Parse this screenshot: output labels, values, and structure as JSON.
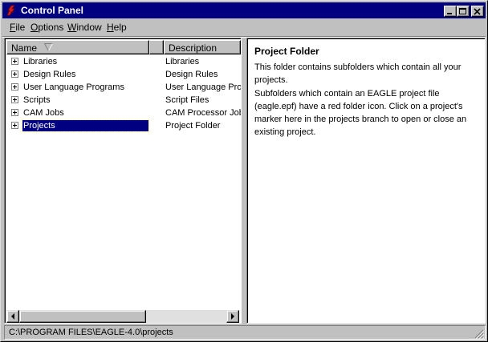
{
  "window": {
    "title": "Control Panel",
    "app_icon": "eagle-icon",
    "controls": [
      "minimize-icon",
      "maximize-icon",
      "close-icon"
    ]
  },
  "menu": {
    "items": [
      {
        "label": "File",
        "accel": "F"
      },
      {
        "label": "Options",
        "accel": "O"
      },
      {
        "label": "Window",
        "accel": "W"
      },
      {
        "label": "Help",
        "accel": "H"
      }
    ]
  },
  "tree": {
    "columns": {
      "name": "Name",
      "description": "Description"
    },
    "sort_icon": "sort-descending-icon",
    "rows": [
      {
        "name": "Libraries",
        "description": "Libraries"
      },
      {
        "name": "Design Rules",
        "description": "Design Rules"
      },
      {
        "name": "User Language Programs",
        "description": "User Language Prog"
      },
      {
        "name": "Scripts",
        "description": "Script Files"
      },
      {
        "name": "CAM Jobs",
        "description": "CAM Processor Job"
      },
      {
        "name": "Projects",
        "description": "Project Folder",
        "selected": true
      }
    ]
  },
  "info": {
    "title": "Project Folder",
    "paragraphs": [
      "This folder contains subfolders which contain all your projects.",
      "Subfolders which contain an EAGLE project file (eagle.epf) have a red folder icon. Click on a project's marker here in the projects branch to open or close an existing project."
    ]
  },
  "status": {
    "path": "C:\\PROGRAM FILES\\EAGLE-4.0\\projects"
  },
  "colors": {
    "titlebar": "#000080",
    "selection": "#000080",
    "face": "#c0c0c0",
    "app_icon": "#d42020"
  }
}
